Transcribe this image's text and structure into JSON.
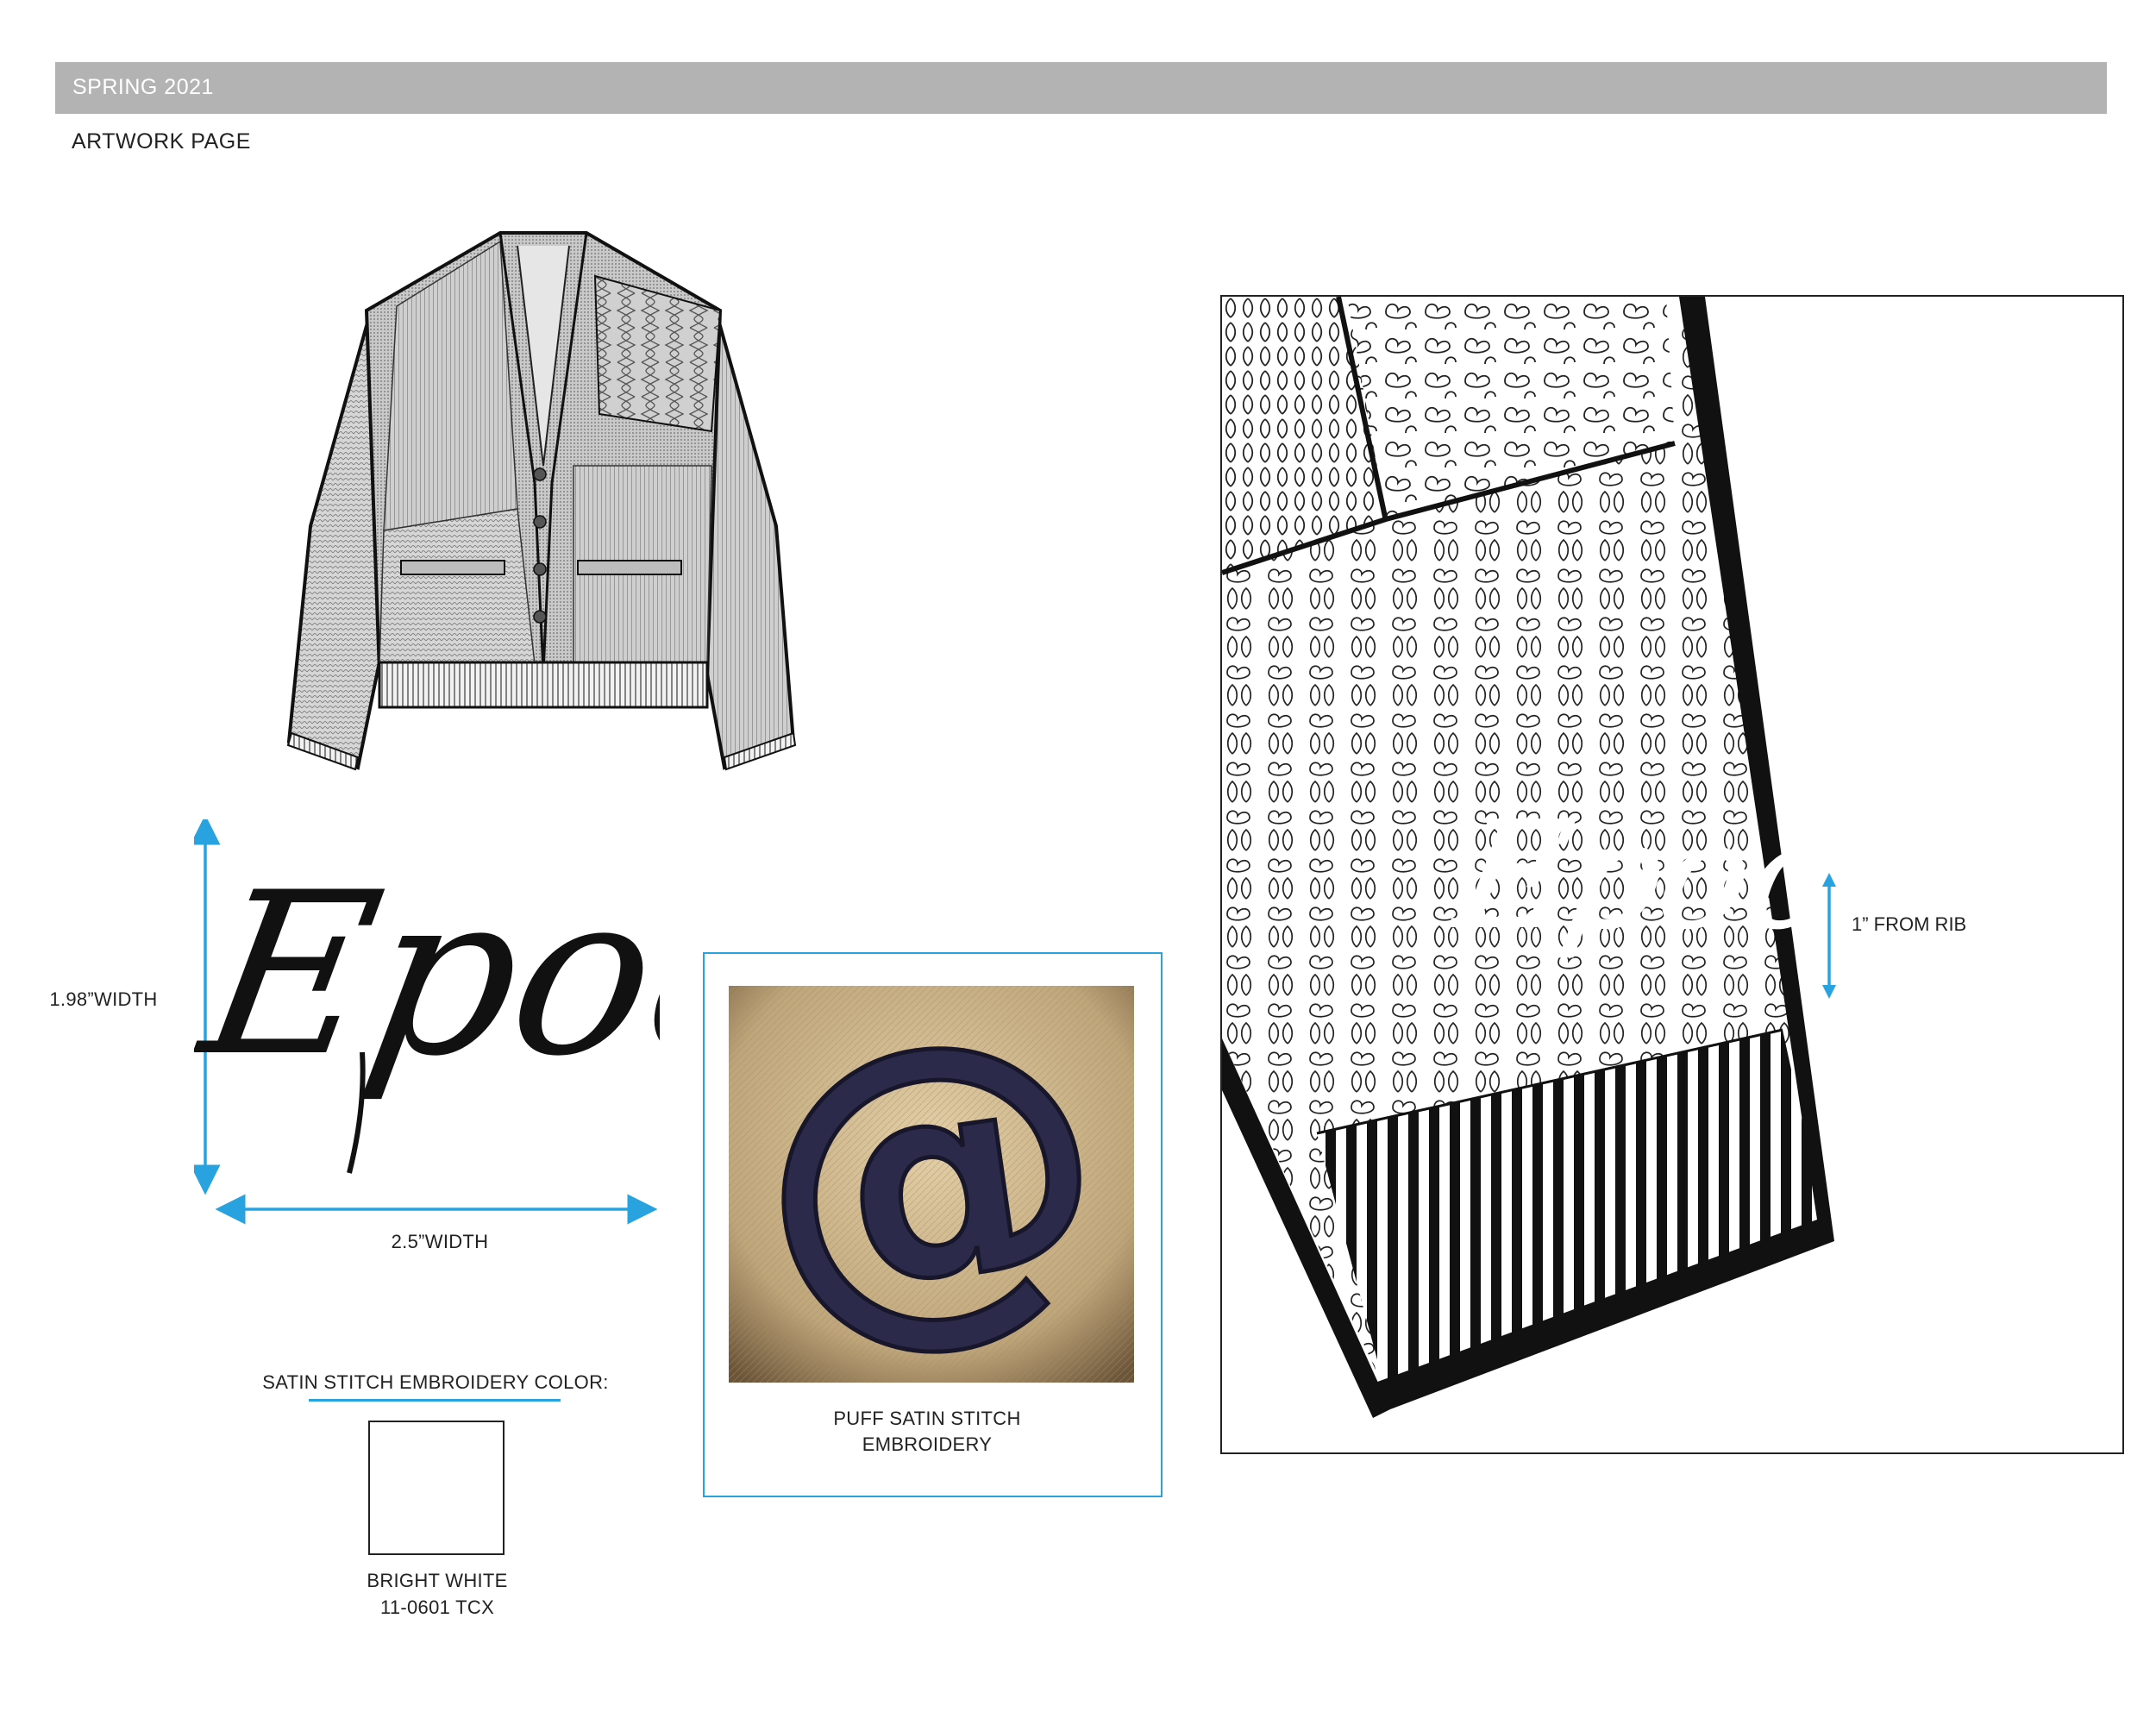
{
  "header": {
    "season": "SPRING 2021"
  },
  "page": {
    "title": "ARTWORK PAGE"
  },
  "logo": {
    "text": "Epoc",
    "height_label": "1.98”WIDTH",
    "width_label": "2.5”WIDTH"
  },
  "embroidery_color": {
    "heading": "SATIN STITCH EMBROIDERY COLOR:",
    "color_name": "BRIGHT WHITE",
    "color_code": "11-0601 TCX",
    "swatch_hex": "#ffffff"
  },
  "reference": {
    "caption_line1": "PUFF SATIN STITCH",
    "caption_line2": "EMBROIDERY",
    "glyph": "@"
  },
  "detail": {
    "placement_label": "1” FROM RIB",
    "logo_text": "Epoc"
  },
  "colors": {
    "accent": "#29a3e0",
    "header_bg": "#b3b3b3",
    "navy_thread": "#2c2a4a"
  }
}
